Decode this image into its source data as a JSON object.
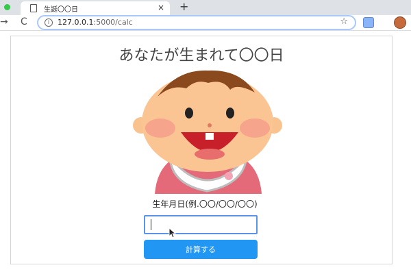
{
  "browser": {
    "tab_title": "生誕〇〇日",
    "tab_close": "×",
    "new_tab": "+",
    "url_host": "127.0.0.1",
    "url_path": ":5000/calc",
    "nav_back": "→",
    "reload": "C",
    "star": "☆",
    "info": "i"
  },
  "page": {
    "title": "あなたが生まれて〇〇日",
    "dob_label": "生年月日(例.〇〇/〇〇/〇〇)",
    "dob_value": "",
    "button_label": "計算する"
  },
  "colors": {
    "accent": "#2196f3",
    "input_focus": "#5b93e8",
    "traffic_green": "#35c84a"
  },
  "icons": {
    "tab": "document-icon",
    "omnibox": "info-icon",
    "bookmark": "star-icon",
    "extension": "extension-icon",
    "profile": "profile-avatar-icon"
  }
}
